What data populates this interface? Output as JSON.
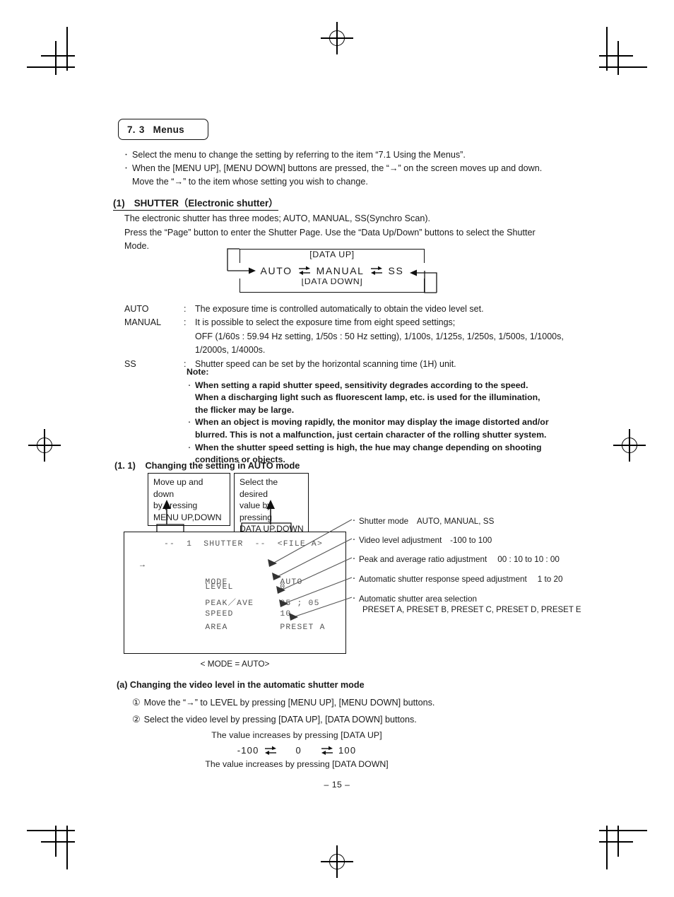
{
  "section": {
    "num1": "7.",
    "num2": "3",
    "title": "Menus"
  },
  "intro": {
    "bullet1": "Select the menu to change the setting by referring to the item “7.1 Using the Menus”.",
    "bullet2": "When the [MENU UP], [MENU DOWN] buttons are pressed, the “→” on the screen moves up and down.",
    "bullet2_cont": "Move the “→” to the item whose setting you wish to change."
  },
  "shutter_heading": {
    "number": "(1)",
    "title": "SHUTTER（Electronic shutter）"
  },
  "shutter_intro": {
    "line1": "The electronic shutter has three modes; AUTO, MANUAL, SS(Synchro Scan).",
    "line2": "Press the “Page” button to enter the Shutter Page. Use the “Data Up/Down” buttons to select the Shutter",
    "line3": "Mode."
  },
  "cycle_diagram": {
    "label_up": "[DATA UP]",
    "label_down": "[DATA DOWN]",
    "modes": [
      "AUTO",
      "MANUAL",
      "SS"
    ]
  },
  "definitions": [
    {
      "term": "AUTO",
      "colon": ":",
      "lines": [
        "The exposure time is controlled automatically to obtain the video level set."
      ]
    },
    {
      "term": "MANUAL",
      "colon": ":",
      "lines": [
        "It is possible to select the exposure time from eight speed settings;",
        "OFF (1/60s : 59.94 Hz setting, 1/50s : 50 Hz setting), 1/100s, 1/125s, 1/250s, 1/500s, 1/1000s,",
        "1/2000s, 1/4000s."
      ]
    },
    {
      "term": "SS",
      "colon": ":",
      "lines": [
        "Shutter speed can be set by the horizontal scanning time (1H) unit."
      ]
    }
  ],
  "note": {
    "heading": "Note:",
    "items": [
      [
        "When setting a rapid shutter speed, sensitivity degrades according to the speed.",
        "When a discharging light such as fluorescent lamp, etc. is used for the illumination,",
        "the flicker may be large."
      ],
      [
        "When an object is moving rapidly, the monitor  may display the image distorted and/or",
        "blurred. This is not a malfunction, just certain character of the rolling shutter system."
      ],
      [
        "When the shutter speed setting is high, the hue may change depending on shooting",
        "conditions or objects."
      ]
    ]
  },
  "subsection_11": {
    "number": "(1. 1)",
    "title": "Changing the setting in AUTO mode"
  },
  "callouts": [
    {
      "lines": [
        "Move up and down",
        "by pressing",
        "MENU UP,DOWN"
      ]
    },
    {
      "lines": [
        "Select the desired",
        "value by pressing",
        "DATA UP,DOWN"
      ]
    }
  ],
  "osd": {
    "title": "--  1  SHUTTER  --  <FILE A>",
    "cursor": "→",
    "rows": [
      {
        "label": "MODE",
        "value": "AUTO",
        "selected": true
      },
      {
        "label": "LEVEL",
        "value": "0",
        "selected": false
      },
      {
        "label": "PEAK／AVE",
        "value": "05 ; 05",
        "selected": false
      },
      {
        "label": "SPEED",
        "value": "10",
        "selected": false
      },
      {
        "label": "AREA",
        "value": "PRESET A",
        "selected": false
      }
    ]
  },
  "screen_caption": "< MODE = AUTO>",
  "annotations": [
    {
      "text": "Shutter mode AUTO, MANUAL, SS",
      "sub": ""
    },
    {
      "text": "Video level adjustment -100 to 100",
      "sub": ""
    },
    {
      "text": "Peak and average ratio adjustment  00 : 10 to 10 : 00",
      "sub": ""
    },
    {
      "text": "Automatic shutter response speed adjustment  1 to 20",
      "sub": ""
    },
    {
      "text": "Automatic shutter area selection",
      "sub": "PRESET A, PRESET B, PRESET C, PRESET D, PRESET E"
    }
  ],
  "section_a": {
    "heading": "(a) Changing the video level in the automatic shutter mode",
    "steps": [
      {
        "num": "①",
        "text": "Move the “→” to LEVEL by pressing [MENU UP], [MENU DOWN] buttons."
      },
      {
        "num": "②",
        "text": "Select the video level by pressing [DATA UP], [DATA DOWN] buttons."
      }
    ]
  },
  "value_range": {
    "top": "The value increases by pressing [DATA UP]",
    "bottom": "The value increases by pressing [DATA DOWN]",
    "values": [
      "-100",
      "0",
      "100"
    ]
  },
  "page_number": "– 15 –",
  "colors": {
    "ink": "#1a1a1a",
    "osd_text": "#555555",
    "rule": "#111111"
  }
}
